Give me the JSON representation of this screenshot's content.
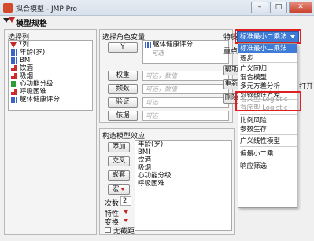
{
  "window": {
    "title": "拟合模型 - JMP Pro",
    "min": "–",
    "max": "□",
    "close": "✕"
  },
  "platform": {
    "title": "模型规格"
  },
  "select_columns": {
    "label": "选择列",
    "count": "7列",
    "columns": [
      {
        "name": "年龄(岁)",
        "type": "continuous"
      },
      {
        "name": "BMI",
        "type": "continuous"
      },
      {
        "name": "饮酒",
        "type": "nominal"
      },
      {
        "name": "吸烟",
        "type": "nominal"
      },
      {
        "name": "心功能分级",
        "type": "ordinal"
      },
      {
        "name": "呼吸困难",
        "type": "nominal"
      },
      {
        "name": "躯体健康评分",
        "type": "continuous"
      }
    ]
  },
  "roles": {
    "label": "选择角色变量",
    "y_button": "Y",
    "y_value": "躯体健康评分",
    "y_optional": "可选",
    "weight_button": "权重",
    "weight_placeholder": "可选，数值",
    "freq_button": "频数",
    "freq_placeholder": "可选，数值",
    "validation_button": "验证",
    "validation_placeholder": "可选",
    "by_button": "依据",
    "by_placeholder": "可选"
  },
  "effects": {
    "label": "构造模型效应",
    "add_button": "添加",
    "cross_button": "交叉",
    "nest_button": "嵌套",
    "macro_button": "宏",
    "degree_label": "次数",
    "degree_value": "2",
    "attribute_label": "特性",
    "transform_label": "变换",
    "no_intercept_label": "无截距",
    "terms": [
      "年龄(岁)",
      "BMI",
      "饮酒",
      "吸烟",
      "心功能分级",
      "呼吸困难"
    ]
  },
  "personality": {
    "label": "特质",
    "selected": "标准最小二乘法",
    "emphasis_label": "重点:",
    "side_buttons": [
      "帮助",
      "重新",
      "删除"
    ],
    "side_text": "打开",
    "menu": [
      {
        "label": "标准最小二乘法",
        "state": "highlight"
      },
      {
        "label": "逐步",
        "state": "normal"
      },
      {
        "label": "广义回归",
        "state": "normal"
      },
      {
        "label": "混合模型",
        "state": "normal"
      },
      {
        "label": "多元方差分析",
        "state": "normal"
      },
      {
        "label": "对数线性方差",
        "state": "normal"
      },
      {
        "label": "名义型 Logistic",
        "state": "disabled"
      },
      {
        "label": "有序型 Logistic",
        "state": "disabled"
      },
      {
        "label": "比例风险",
        "state": "normal"
      },
      {
        "label": "参数生存",
        "state": "normal"
      },
      {
        "label": "广义线性模型",
        "state": "normal"
      },
      {
        "label": "偏最小二乘",
        "state": "normal"
      },
      {
        "label": "响应筛选",
        "state": "normal"
      }
    ]
  },
  "colors": {
    "highlight": "#3d7bd6",
    "annotation": "#e02020",
    "hotspot": "#c62828"
  }
}
